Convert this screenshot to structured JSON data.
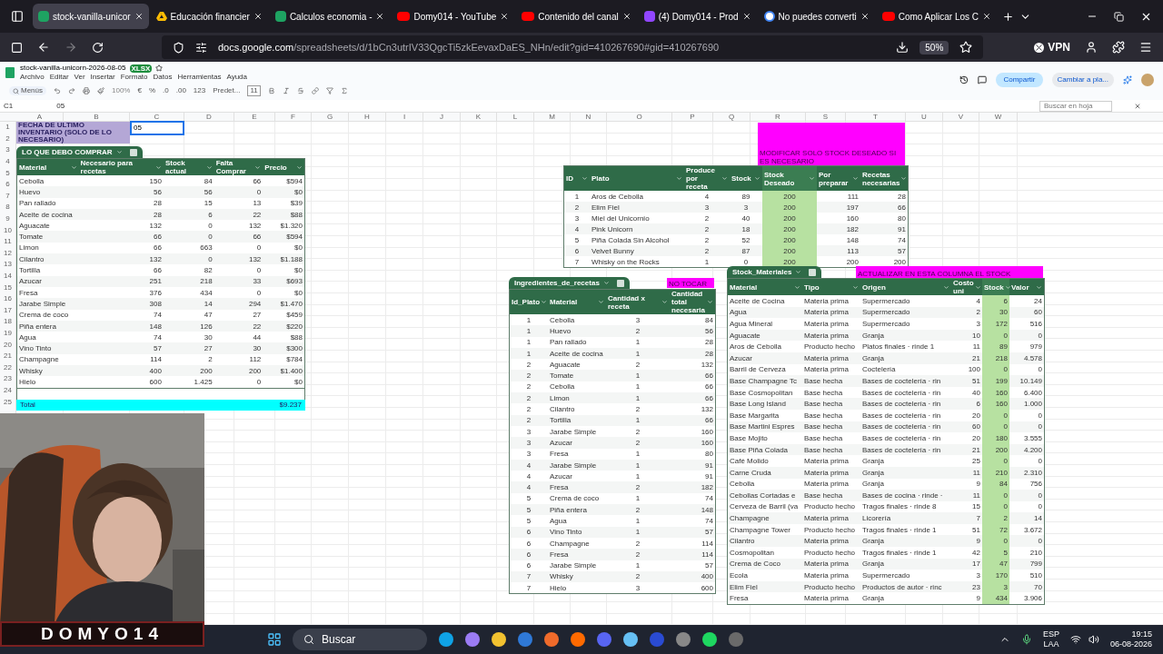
{
  "browser": {
    "tabs": [
      {
        "title": "stock-vanilla-unicor",
        "kind": "sheets",
        "selected": true
      },
      {
        "title": "Educación financier",
        "kind": "drive",
        "selected": false
      },
      {
        "title": "Calculos economia -",
        "kind": "sheets",
        "selected": false
      },
      {
        "title": "Domy014 - YouTube",
        "kind": "youtube",
        "selected": false
      },
      {
        "title": "Contenido del canal",
        "kind": "youtube",
        "selected": false
      },
      {
        "title": "(4) Domy014 - Prod",
        "kind": "twitch",
        "selected": false
      },
      {
        "title": "No puedes converti",
        "kind": "google",
        "selected": false
      },
      {
        "title": "Como Aplicar Los C",
        "kind": "youtube",
        "selected": false
      }
    ],
    "url_host": "docs.google.com",
    "url_path": "/spreadsheets/d/1bCn3utrIV33QgcTi5zkEevaxDaES_NHn/edit?gid=410267690#gid=410267690",
    "zoom": "50%",
    "vpn": "VPN"
  },
  "sheet": {
    "title": "stock-vanilla-unicorn-2026-08-05",
    "badge": "XLSX",
    "menu": [
      "Archivo",
      "Editar",
      "Ver",
      "Insertar",
      "Formato",
      "Datos",
      "Herramientas",
      "Ayuda"
    ],
    "menus_button": "Menús",
    "zoom": "100%",
    "toolbar_texts": [
      "€",
      "%",
      ".0",
      ".00",
      "123"
    ],
    "font": "Predet...",
    "font_size": "11",
    "share": "Compartir",
    "switch": "Cambiar a pla...",
    "cell_ref": "C1",
    "formula": "05",
    "find_placeholder": "Buscar en hoja",
    "columns": [
      "A",
      "B",
      "C",
      "D",
      "E",
      "F",
      "G",
      "H",
      "I",
      "J",
      "K",
      "L",
      "M",
      "N",
      "O",
      "P",
      "Q",
      "R",
      "S",
      "T",
      "U",
      "V",
      "W"
    ],
    "rows": [
      "1",
      "2",
      "3",
      "4",
      "5",
      "6",
      "7",
      "8",
      "9",
      "10",
      "11",
      "12",
      "13",
      "14",
      "15",
      "16",
      "17",
      "18",
      "19",
      "20",
      "21",
      "22",
      "23",
      "24",
      "25"
    ],
    "a1": "FECHA DE ULTIMO INVENTARIO (SOLO DE LO NECESARIO)",
    "c1": "05"
  },
  "buy_table": {
    "name": "LO QUE DEBO COMPRAR",
    "columns": [
      {
        "label": "Material",
        "highlighted": false
      },
      {
        "label": "Necesario para recetas",
        "highlighted": false
      },
      {
        "label": "Stock actual",
        "highlighted": false
      },
      {
        "label": "Falta Comprar",
        "highlighted": false
      },
      {
        "label": "Precio",
        "highlighted": false
      }
    ],
    "rows": [
      [
        "Cebolla",
        "150",
        "84",
        "66",
        "$594"
      ],
      [
        "Huevo",
        "56",
        "56",
        "0",
        "$0"
      ],
      [
        "Pan rallado",
        "28",
        "15",
        "13",
        "$39"
      ],
      [
        "Aceite de cocina",
        "28",
        "6",
        "22",
        "$88"
      ],
      [
        "Aguacate",
        "132",
        "0",
        "132",
        "$1.320"
      ],
      [
        "Tomate",
        "66",
        "0",
        "66",
        "$594"
      ],
      [
        "Limon",
        "66",
        "663",
        "0",
        "$0"
      ],
      [
        "Cilantro",
        "132",
        "0",
        "132",
        "$1.188"
      ],
      [
        "Tortilla",
        "66",
        "82",
        "0",
        "$0"
      ],
      [
        "Azucar",
        "251",
        "218",
        "33",
        "$693"
      ],
      [
        "Fresa",
        "376",
        "434",
        "0",
        "$0"
      ],
      [
        "Jarabe Simple",
        "308",
        "14",
        "294",
        "$1.470"
      ],
      [
        "Crema de coco",
        "74",
        "47",
        "27",
        "$459"
      ],
      [
        "Piña entera",
        "148",
        "126",
        "22",
        "$220"
      ],
      [
        "Agua",
        "74",
        "30",
        "44",
        "$88"
      ],
      [
        "Vino Tinto",
        "57",
        "27",
        "30",
        "$300"
      ],
      [
        "Champagne",
        "114",
        "2",
        "112",
        "$784"
      ],
      [
        "Whisky",
        "400",
        "200",
        "200",
        "$1.400"
      ],
      [
        "Hielo",
        "600",
        "1.425",
        "0",
        "$0"
      ]
    ],
    "total_label": "Total",
    "total_value": "$9.237"
  },
  "dishes_note": "MODIFICAR SOLO STOCK DESEADO SI ES NECESARIO",
  "dishes_table": {
    "columns": [
      {
        "label": "ID",
        "highlighted": false
      },
      {
        "label": "Plato",
        "highlighted": false
      },
      {
        "label": "Produce por receta",
        "highlighted": false
      },
      {
        "label": "Stock",
        "highlighted": false
      },
      {
        "label": "Stock Deseado",
        "highlighted": true
      },
      {
        "label": "Por preparar",
        "highlighted": false
      },
      {
        "label": "Recetas necesarias",
        "highlighted": false
      }
    ],
    "rows": [
      [
        "1",
        "Aros de Cebolla",
        "4",
        "89",
        "200",
        "111",
        "28"
      ],
      [
        "2",
        "Elim Fiel",
        "3",
        "3",
        "200",
        "197",
        "66"
      ],
      [
        "3",
        "Miel del Unicornio",
        "2",
        "40",
        "200",
        "160",
        "80"
      ],
      [
        "4",
        "Pink Unicorn",
        "2",
        "18",
        "200",
        "182",
        "91"
      ],
      [
        "5",
        "Piña Colada Sin Alcohol",
        "2",
        "52",
        "200",
        "148",
        "74"
      ],
      [
        "6",
        "Velvet Bunny",
        "2",
        "87",
        "200",
        "113",
        "57"
      ],
      [
        "7",
        "Whisky on the Rocks",
        "1",
        "0",
        "200",
        "200",
        "200"
      ]
    ]
  },
  "ingredients_note": "NO TOCAR",
  "ingredients_table": {
    "name": "Ingredientes_de_recetas",
    "columns": [
      {
        "label": "Id_Plato",
        "highlighted": false
      },
      {
        "label": "Material",
        "highlighted": false
      },
      {
        "label": "Cantidad x receta",
        "highlighted": false
      },
      {
        "label": "Cantidad total necesaria",
        "highlighted": false
      }
    ],
    "rows": [
      [
        "1",
        "Cebolla",
        "3",
        "84"
      ],
      [
        "1",
        "Huevo",
        "2",
        "56"
      ],
      [
        "1",
        "Pan rallado",
        "1",
        "28"
      ],
      [
        "1",
        "Aceite de cocina",
        "1",
        "28"
      ],
      [
        "2",
        "Aguacate",
        "2",
        "132"
      ],
      [
        "2",
        "Tomate",
        "1",
        "66"
      ],
      [
        "2",
        "Cebolla",
        "1",
        "66"
      ],
      [
        "2",
        "Limon",
        "1",
        "66"
      ],
      [
        "2",
        "Cilantro",
        "2",
        "132"
      ],
      [
        "2",
        "Tortilla",
        "1",
        "66"
      ],
      [
        "3",
        "Jarabe Simple",
        "2",
        "160"
      ],
      [
        "3",
        "Azucar",
        "2",
        "160"
      ],
      [
        "3",
        "Fresa",
        "1",
        "80"
      ],
      [
        "4",
        "Jarabe Simple",
        "1",
        "91"
      ],
      [
        "4",
        "Azucar",
        "1",
        "91"
      ],
      [
        "4",
        "Fresa",
        "2",
        "182"
      ],
      [
        "5",
        "Crema de coco",
        "1",
        "74"
      ],
      [
        "5",
        "Piña entera",
        "2",
        "148"
      ],
      [
        "5",
        "Agua",
        "1",
        "74"
      ],
      [
        "6",
        "Vino Tinto",
        "1",
        "57"
      ],
      [
        "6",
        "Champagne",
        "2",
        "114"
      ],
      [
        "6",
        "Fresa",
        "2",
        "114"
      ],
      [
        "6",
        "Jarabe Simple",
        "1",
        "57"
      ],
      [
        "7",
        "Whisky",
        "2",
        "400"
      ],
      [
        "7",
        "Hielo",
        "3",
        "600"
      ]
    ]
  },
  "stock_note": "ACTUALIZAR EN ESTA COLUMNA EL STOCK",
  "stock_table": {
    "name": "Stock_Materiales",
    "columns": [
      {
        "label": "Material",
        "highlighted": false
      },
      {
        "label": "Tipo",
        "highlighted": false
      },
      {
        "label": "Origen",
        "highlighted": false
      },
      {
        "label": "Costo uni",
        "highlighted": false
      },
      {
        "label": "Stock",
        "highlighted": true
      },
      {
        "label": "Valor",
        "highlighted": false
      }
    ],
    "rows": [
      [
        "Aceite de Cocina",
        "Materia prima",
        "Supermercado",
        "4",
        "6",
        "24"
      ],
      [
        "Agua",
        "Materia prima",
        "Supermercado",
        "2",
        "30",
        "60"
      ],
      [
        "Agua Mineral",
        "Materia prima",
        "Supermercado",
        "3",
        "172",
        "516"
      ],
      [
        "Aguacate",
        "Materia prima",
        "Granja",
        "10",
        "0",
        "0"
      ],
      [
        "Aros de Cebolla",
        "Producto hecho",
        "Platos finales · rinde 1",
        "11",
        "89",
        "979"
      ],
      [
        "Azucar",
        "Materia prima",
        "Granja",
        "21",
        "218",
        "4.578"
      ],
      [
        "Barril de Cerveza",
        "Materia prima",
        "Coctelería",
        "100",
        "0",
        "0"
      ],
      [
        "Base Champagne Tc",
        "Base hecha",
        "Bases de coctelería · rin",
        "51",
        "199",
        "10.149"
      ],
      [
        "Base Cosmopolitan",
        "Base hecha",
        "Bases de coctelería · rin",
        "40",
        "160",
        "6.400"
      ],
      [
        "Base Long Island",
        "Base hecha",
        "Bases de coctelería · rin",
        "6",
        "160",
        "1.000"
      ],
      [
        "Base Margarita",
        "Base hecha",
        "Bases de coctelería · rin",
        "20",
        "0",
        "0"
      ],
      [
        "Base Martini Espres",
        "Base hecha",
        "Bases de coctelería · rin",
        "60",
        "0",
        "0"
      ],
      [
        "Base Mojito",
        "Base hecha",
        "Bases de coctelería · rin",
        "20",
        "180",
        "3.555"
      ],
      [
        "Base Piña Colada",
        "Base hecha",
        "Bases de coctelería · rin",
        "21",
        "200",
        "4.200"
      ],
      [
        "Café Molido",
        "Materia prima",
        "Granja",
        "25",
        "0",
        "0"
      ],
      [
        "Carne Cruda",
        "Materia prima",
        "Granja",
        "11",
        "210",
        "2.310"
      ],
      [
        "Cebolla",
        "Materia prima",
        "Granja",
        "9",
        "84",
        "756"
      ],
      [
        "Cebollas Cortadas e",
        "Base hecha",
        "Bases de cocina · rinde ·",
        "11",
        "0",
        "0"
      ],
      [
        "Cerveza de Barril (va",
        "Producto hecho",
        "Tragos finales · rinde 8",
        "15",
        "0",
        "0"
      ],
      [
        "Champagne",
        "Materia prima",
        "Licorería",
        "7",
        "2",
        "14"
      ],
      [
        "Champagne Tower",
        "Producto hecho",
        "Tragos finales · rinde 1",
        "51",
        "72",
        "3.672"
      ],
      [
        "Cilantro",
        "Materia prima",
        "Granja",
        "9",
        "0",
        "0"
      ],
      [
        "Cosmopolitan",
        "Producto hecho",
        "Tragos finales · rinde 1",
        "42",
        "5",
        "210"
      ],
      [
        "Crema de Coco",
        "Materia prima",
        "Granja",
        "17",
        "47",
        "799"
      ],
      [
        "Ecola",
        "Materia prima",
        "Supermercado",
        "3",
        "170",
        "510"
      ],
      [
        "Elim Fiel",
        "Producto hecho",
        "Productos de autor · rinc",
        "23",
        "3",
        "70"
      ],
      [
        "Fresa",
        "Materia prima",
        "Granja",
        "9",
        "434",
        "3.906"
      ]
    ]
  },
  "overlay": {
    "logo": "DOMYO14"
  },
  "taskbar": {
    "search": "Buscar",
    "lang": "ESP",
    "layout": "LAA",
    "time": "19:15",
    "date": "06-08-2026"
  }
}
